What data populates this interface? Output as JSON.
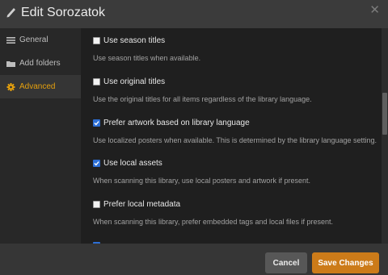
{
  "dialog": {
    "title": "Edit Sorozatok",
    "close_icon": "close-icon",
    "edit_icon": "pencil-icon"
  },
  "colors": {
    "accent": "#e5a00d",
    "save_button": "#cc7b19",
    "checkbox_checked": "#2d6fd6"
  },
  "sidebar": {
    "items": [
      {
        "label": "General",
        "icon": "list-icon",
        "active": false
      },
      {
        "label": "Add folders",
        "icon": "folder-icon",
        "active": false
      },
      {
        "label": "Advanced",
        "icon": "gear-icon",
        "active": true
      }
    ]
  },
  "options": [
    {
      "label": "Use season titles",
      "checked": false,
      "description": "Use season titles when available."
    },
    {
      "label": "Use original titles",
      "checked": false,
      "description": "Use the original titles for all items regardless of the library language."
    },
    {
      "label": "Prefer artwork based on library language",
      "checked": true,
      "description": "Use localized posters when available. This is determined by the library language setting."
    },
    {
      "label": "Use local assets",
      "checked": true,
      "description": "When scanning this library, use local posters and artwork if present."
    },
    {
      "label": "Prefer local metadata",
      "checked": false,
      "description": "When scanning this library, prefer embedded tags and local files if present."
    }
  ],
  "footer": {
    "cancel_label": "Cancel",
    "save_label": "Save Changes"
  }
}
